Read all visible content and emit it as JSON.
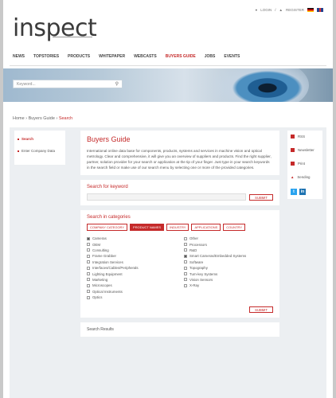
{
  "header": {
    "logo": "inspect",
    "login": "LOGIN",
    "register": "REGISTER"
  },
  "nav": [
    "NEWS",
    "TOPSTORIES",
    "PRODUCTS",
    "WHITEPAPER",
    "WEBCASTS",
    "BUYERS GUIDE",
    "JOBS",
    "EVENTS"
  ],
  "hero": {
    "search_placeholder": "Keyword..."
  },
  "breadcrumb": {
    "home": "Home",
    "sep": "›",
    "guide": "Buyers Guide",
    "current": "Search"
  },
  "leftnav": [
    "Search",
    "Enter Company Data"
  ],
  "intro": {
    "title": "Buyers Guide",
    "text": "International online data base for components, products, systems and services in machine vision and optical metrology. Clear and comprehensive, it will give you an overview of suppliers and products. Find the right supplier, partner, solution provider for your search or application at the tip of your finger. Just type in your search keywords in the search field or make use of our search menu by selecting one or more of the provided categories."
  },
  "keyword_search": {
    "title": "Search for keyword",
    "submit": "SUBMIT"
  },
  "categories": {
    "title": "Search in categories",
    "tabs": [
      "COMPANY CATEGORY",
      "PRODUCT NAMES",
      "INDUSTRY",
      "APPLICATIONS",
      "COUNTRY"
    ],
    "left": [
      {
        "label": "Cameras",
        "on": true
      },
      {
        "label": "OEM",
        "on": false
      },
      {
        "label": "Consulting",
        "on": false
      },
      {
        "label": "Frame Grabber",
        "on": false
      },
      {
        "label": "Integration Services",
        "on": false
      },
      {
        "label": "Interfaces/Cables/Peripherals",
        "on": false
      },
      {
        "label": "Lighting Equipment",
        "on": false
      },
      {
        "label": "Marketing",
        "on": false
      },
      {
        "label": "Microscopes",
        "on": false
      },
      {
        "label": "Optical Instruments",
        "on": false
      },
      {
        "label": "Optics",
        "on": false
      }
    ],
    "right": [
      {
        "label": "Other",
        "on": false
      },
      {
        "label": "Processors",
        "on": false
      },
      {
        "label": "R&D",
        "on": false
      },
      {
        "label": "Smart Cameras/Embedded Systems",
        "on": true
      },
      {
        "label": "Software",
        "on": false
      },
      {
        "label": "Topography",
        "on": false
      },
      {
        "label": "Turn-key Systems",
        "on": false
      },
      {
        "label": "Vision Sensors",
        "on": false
      },
      {
        "label": "X-Ray",
        "on": false
      }
    ],
    "submit": "SUBMIT"
  },
  "results": {
    "title": "Search Results"
  },
  "rightbar": {
    "items": [
      "RSS",
      "Newsletter",
      "Print",
      "Sending"
    ],
    "social": [
      "t",
      "in"
    ]
  },
  "colors": {
    "accent": "#c52a2a",
    "twitter": "#2aa3ef",
    "linkedin": "#1e73b1"
  }
}
